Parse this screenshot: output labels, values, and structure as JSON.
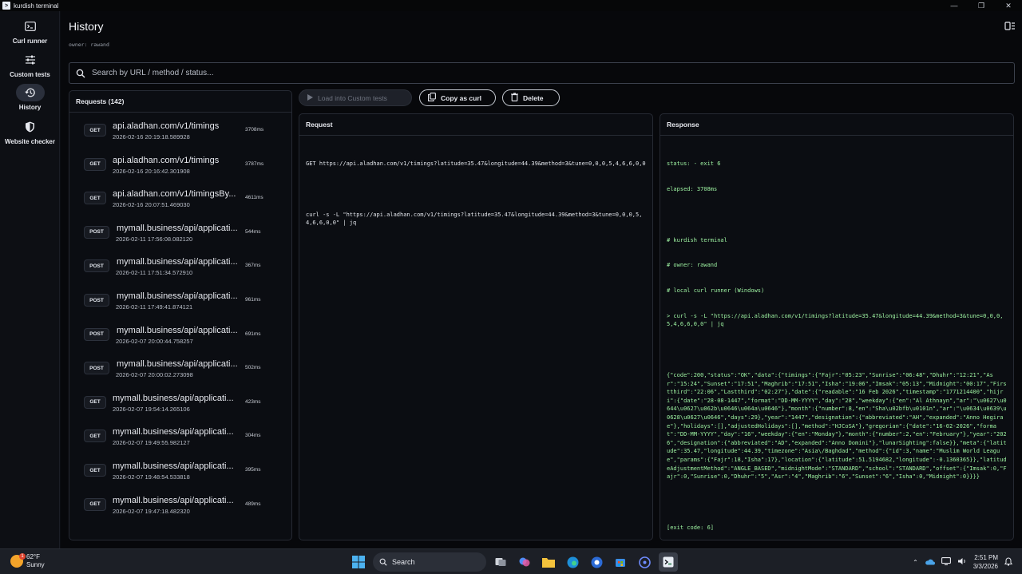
{
  "window": {
    "title": "kurdish terminal",
    "controls": [
      "—",
      "❐",
      "✕"
    ]
  },
  "sidebar": {
    "items": [
      {
        "label": "Curl runner",
        "icon": "terminal-icon"
      },
      {
        "label": "Custom tests",
        "icon": "sliders-icon"
      },
      {
        "label": "History",
        "icon": "history-icon",
        "active": true
      },
      {
        "label": "Website checker",
        "icon": "shield-icon"
      }
    ]
  },
  "page": {
    "title": "History",
    "owner": "owner: rawand"
  },
  "search": {
    "placeholder": "Search by URL / method / status..."
  },
  "requests": {
    "header": "Requests (142)",
    "items": [
      {
        "method": "GET",
        "url": "api.aladhan.com/v1/timings",
        "timestamp": "2026-02-16 20:19:18.589928",
        "duration": "3708ms"
      },
      {
        "method": "GET",
        "url": "api.aladhan.com/v1/timings",
        "timestamp": "2026-02-16 20:16:42.301908",
        "duration": "3787ms"
      },
      {
        "method": "GET",
        "url": "api.aladhan.com/v1/timingsBy...",
        "timestamp": "2026-02-16 20:07:51.469030",
        "duration": "4611ms"
      },
      {
        "method": "POST",
        "url": "mymall.business/api/applicati...",
        "timestamp": "2026-02-11 17:56:08.082120",
        "duration": "544ms"
      },
      {
        "method": "POST",
        "url": "mymall.business/api/applicati...",
        "timestamp": "2026-02-11 17:51:34.572910",
        "duration": "367ms"
      },
      {
        "method": "POST",
        "url": "mymall.business/api/applicati...",
        "timestamp": "2026-02-11 17:49:41.874121",
        "duration": "961ms"
      },
      {
        "method": "POST",
        "url": "mymall.business/api/applicati...",
        "timestamp": "2026-02-07 20:00:44.758257",
        "duration": "691ms"
      },
      {
        "method": "POST",
        "url": "mymall.business/api/applicati...",
        "timestamp": "2026-02-07 20:00:02.273098",
        "duration": "502ms"
      },
      {
        "method": "GET",
        "url": "mymall.business/api/applicati...",
        "timestamp": "2026-02-07 19:54:14.265106",
        "duration": "423ms"
      },
      {
        "method": "GET",
        "url": "mymall.business/api/applicati...",
        "timestamp": "2026-02-07 19:49:55.982127",
        "duration": "304ms"
      },
      {
        "method": "GET",
        "url": "mymall.business/api/applicati...",
        "timestamp": "2026-02-07 19:48:54.533818",
        "duration": "395ms"
      },
      {
        "method": "GET",
        "url": "mymall.business/api/applicati...",
        "timestamp": "2026-02-07 19:47:18.482320",
        "duration": "489ms"
      }
    ]
  },
  "actions": {
    "load_label": "Load into Custom tests",
    "copy_label": "Copy as curl",
    "delete_label": "Delete"
  },
  "request_panel": {
    "header": "Request",
    "line1": "GET https://api.aladhan.com/v1/timings?latitude=35.47&longitude=44.39&method=3&tune=0,0,0,5,4,6,6,0,0",
    "line2": "curl -s -L \"https://api.aladhan.com/v1/timings?latitude=35.47&longitude=44.39&method=3&tune=0,0,0,5,4,6,6,0,0\" | jq"
  },
  "response_panel": {
    "header": "Response",
    "status": "status: - exit 6",
    "elapsed": "elapsed: 3708ms",
    "comment1": "# kurdish terminal",
    "comment2": "# owner: rawand",
    "comment3": "# local curl runner (Windows)",
    "command": "> curl -s -L \"https://api.aladhan.com/v1/timings?latitude=35.47&longitude=44.39&method=3&tune=0,0,0,5,4,6,6,0,0\" | jq",
    "json": "{\"code\":200,\"status\":\"OK\",\"data\":{\"timings\":{\"Fajr\":\"05:23\",\"Sunrise\":\"06:48\",\"Dhuhr\":\"12:21\",\"Asr\":\"15:24\",\"Sunset\":\"17:51\",\"Maghrib\":\"17:51\",\"Isha\":\"19:06\",\"Imsak\":\"05:13\",\"Midnight\":\"00:17\",\"Firstthird\":\"22:06\",\"Lastthird\":\"02:27\"},\"date\":{\"readable\":\"16 Feb 2026\",\"timestamp\":\"1771214400\",\"hijri\":{\"date\":\"28-08-1447\",\"format\":\"DD-MM-YYYY\",\"day\":\"28\",\"weekday\":{\"en\":\"Al Athnayn\",\"ar\":\"\\u0627\\u0644\\u0627\\u062b\\u0646\\u064a\\u0646\"},\"month\":{\"number\":8,\"en\":\"Sha\\u02bfb\\u0101n\",\"ar\":\"\\u0634\\u0639\\u0628\\u0627\\u0646\",\"days\":29},\"year\":\"1447\",\"designation\":{\"abbreviated\":\"AH\",\"expanded\":\"Anno Hegirae\"},\"holidays\":[],\"adjustedHolidays\":[],\"method\":\"HJCoSA\"},\"gregorian\":{\"date\":\"16-02-2026\",\"format\":\"DD-MM-YYYY\",\"day\":\"16\",\"weekday\":{\"en\":\"Monday\"},\"month\":{\"number\":2,\"en\":\"February\"},\"year\":\"2026\",\"designation\":{\"abbreviated\":\"AD\",\"expanded\":\"Anno Domini\"},\"lunarSighting\":false}},\"meta\":{\"latitude\":35.47,\"longitude\":44.39,\"timezone\":\"Asia\\/Baghdad\",\"method\":{\"id\":3,\"name\":\"Muslim World League\",\"params\":{\"Fajr\":18,\"Isha\":17},\"location\":{\"latitude\":51.5194682,\"longitude\":-0.1360365}},\"latitudeAdjustmentMethod\":\"ANGLE_BASED\",\"midnightMode\":\"STANDARD\",\"school\":\"STANDARD\",\"offset\":{\"Imsak\":0,\"Fajr\":0,\"Sunrise\":0,\"Dhuhr\":\"5\",\"Asr\":\"4\",\"Maghrib\":\"6\",\"Sunset\":\"6\",\"Isha\":0,\"Midnight\":0}}}}",
    "exit": "[exit code: 6]"
  },
  "taskbar": {
    "weather_temp": "62°F",
    "weather_desc": "Sunny",
    "weather_badge": "1",
    "search_label": "Search",
    "time": "2:51 PM",
    "date": "3/3/2026"
  },
  "colors": {
    "accent_green": "#9cf0a0",
    "background": "#07080b",
    "panel_border": "#262a33"
  }
}
